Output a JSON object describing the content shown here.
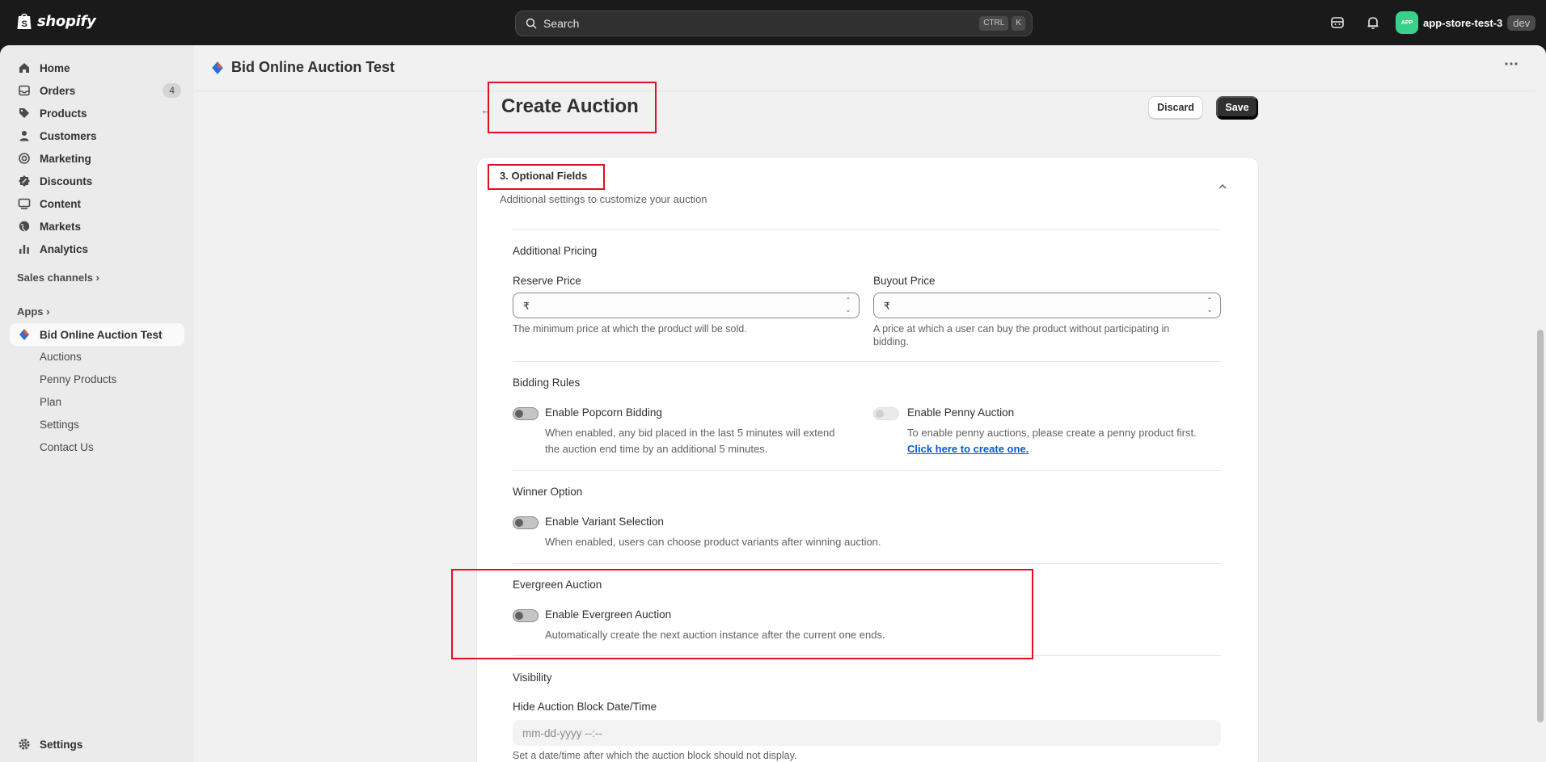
{
  "topbar": {
    "logo_text": "shopify",
    "search_placeholder": "Search",
    "key1": "CTRL",
    "key2": "K",
    "store_avatar": "APP",
    "store_name": "app-store-test-3",
    "store_tag": "dev"
  },
  "sidebar": {
    "items": [
      {
        "label": "Home",
        "icon": "home-icon"
      },
      {
        "label": "Orders",
        "icon": "inbox-icon",
        "badge": "4"
      },
      {
        "label": "Products",
        "icon": "tag-icon"
      },
      {
        "label": "Customers",
        "icon": "person-icon"
      },
      {
        "label": "Marketing",
        "icon": "target-icon"
      },
      {
        "label": "Discounts",
        "icon": "discount-icon"
      },
      {
        "label": "Content",
        "icon": "content-icon"
      },
      {
        "label": "Markets",
        "icon": "globe-icon"
      },
      {
        "label": "Analytics",
        "icon": "chart-icon"
      }
    ],
    "sales_channels": "Sales channels",
    "apps": "Apps",
    "app_name": "Bid Online Auction Test",
    "app_subitems": [
      "Auctions",
      "Penny Products",
      "Plan",
      "Settings",
      "Contact Us"
    ],
    "settings": "Settings"
  },
  "header": {
    "app_title": "Bid Online Auction Test"
  },
  "page": {
    "title": "Create Auction",
    "discard": "Discard",
    "save": "Save"
  },
  "card": {
    "title": "3. Optional Fields",
    "subtitle": "Additional settings to customize your auction",
    "additional_pricing": "Additional Pricing",
    "reserve_label": "Reserve Price",
    "reserve_prefix": "₹",
    "reserve_help": "The minimum price at which the product will be sold.",
    "buyout_label": "Buyout Price",
    "buyout_prefix": "₹",
    "buyout_help_1": "A price at which a user can buy the product without participating in",
    "buyout_help_2": "bidding.",
    "bidding_rules": "Bidding Rules",
    "popcorn_label": "Enable Popcorn Bidding",
    "popcorn_help_1": "When enabled, any bid placed in the last 5 minutes will extend",
    "popcorn_help_2": "the auction end time by an additional 5 minutes.",
    "penny_label": "Enable Penny Auction",
    "penny_help": "To enable penny auctions, please create a penny product first.",
    "penny_link": "Click here to create one.",
    "winner_option": "Winner Option",
    "variant_label": "Enable Variant Selection",
    "variant_help": "When enabled, users can choose product variants after winning auction.",
    "evergreen": "Evergreen Auction",
    "evergreen_label": "Enable Evergreen Auction",
    "evergreen_help": "Automatically create the next auction instance after the current one ends.",
    "visibility": "Visibility",
    "hide_label": "Hide Auction Block Date/Time",
    "hide_placeholder": "mm-dd-yyyy --:--",
    "hide_help": "Set a date/time after which the auction block should not display."
  },
  "colors": {
    "highlight": "#e0101f",
    "link": "#005bd3",
    "avatar": "#36d18a"
  }
}
